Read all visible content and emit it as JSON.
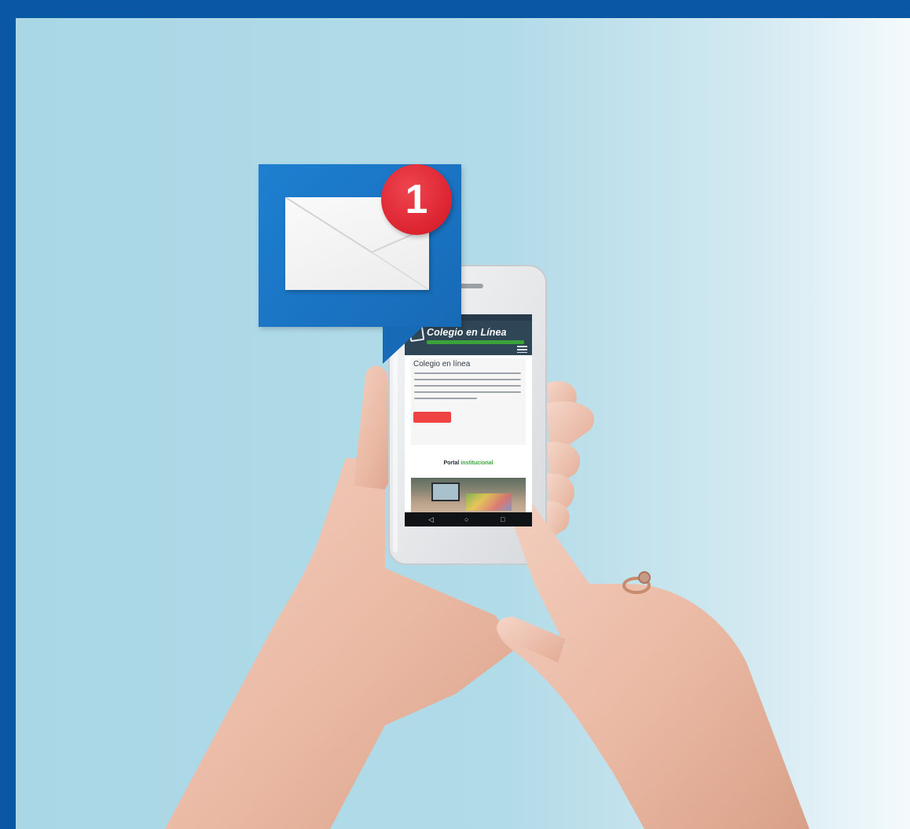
{
  "phone_screen": {
    "site_logo": "Colegio en Línea",
    "hero_title": "Colegio en línea",
    "portal_title_prefix": "Portal ",
    "portal_title_accent": "institucional"
  },
  "notification": {
    "badge_count": "1",
    "bubble_color": "#1a73c2",
    "badge_color": "#dc2330",
    "icon": "envelope-icon"
  },
  "colors": {
    "frame": "#0a57a6",
    "background": "#b2dbe8",
    "app_header": "#2f4657",
    "logo_underline": "#39a33a",
    "hero_button": "#ef4343"
  },
  "navigation_icons": [
    "back-icon",
    "home-icon",
    "recents-icon"
  ]
}
